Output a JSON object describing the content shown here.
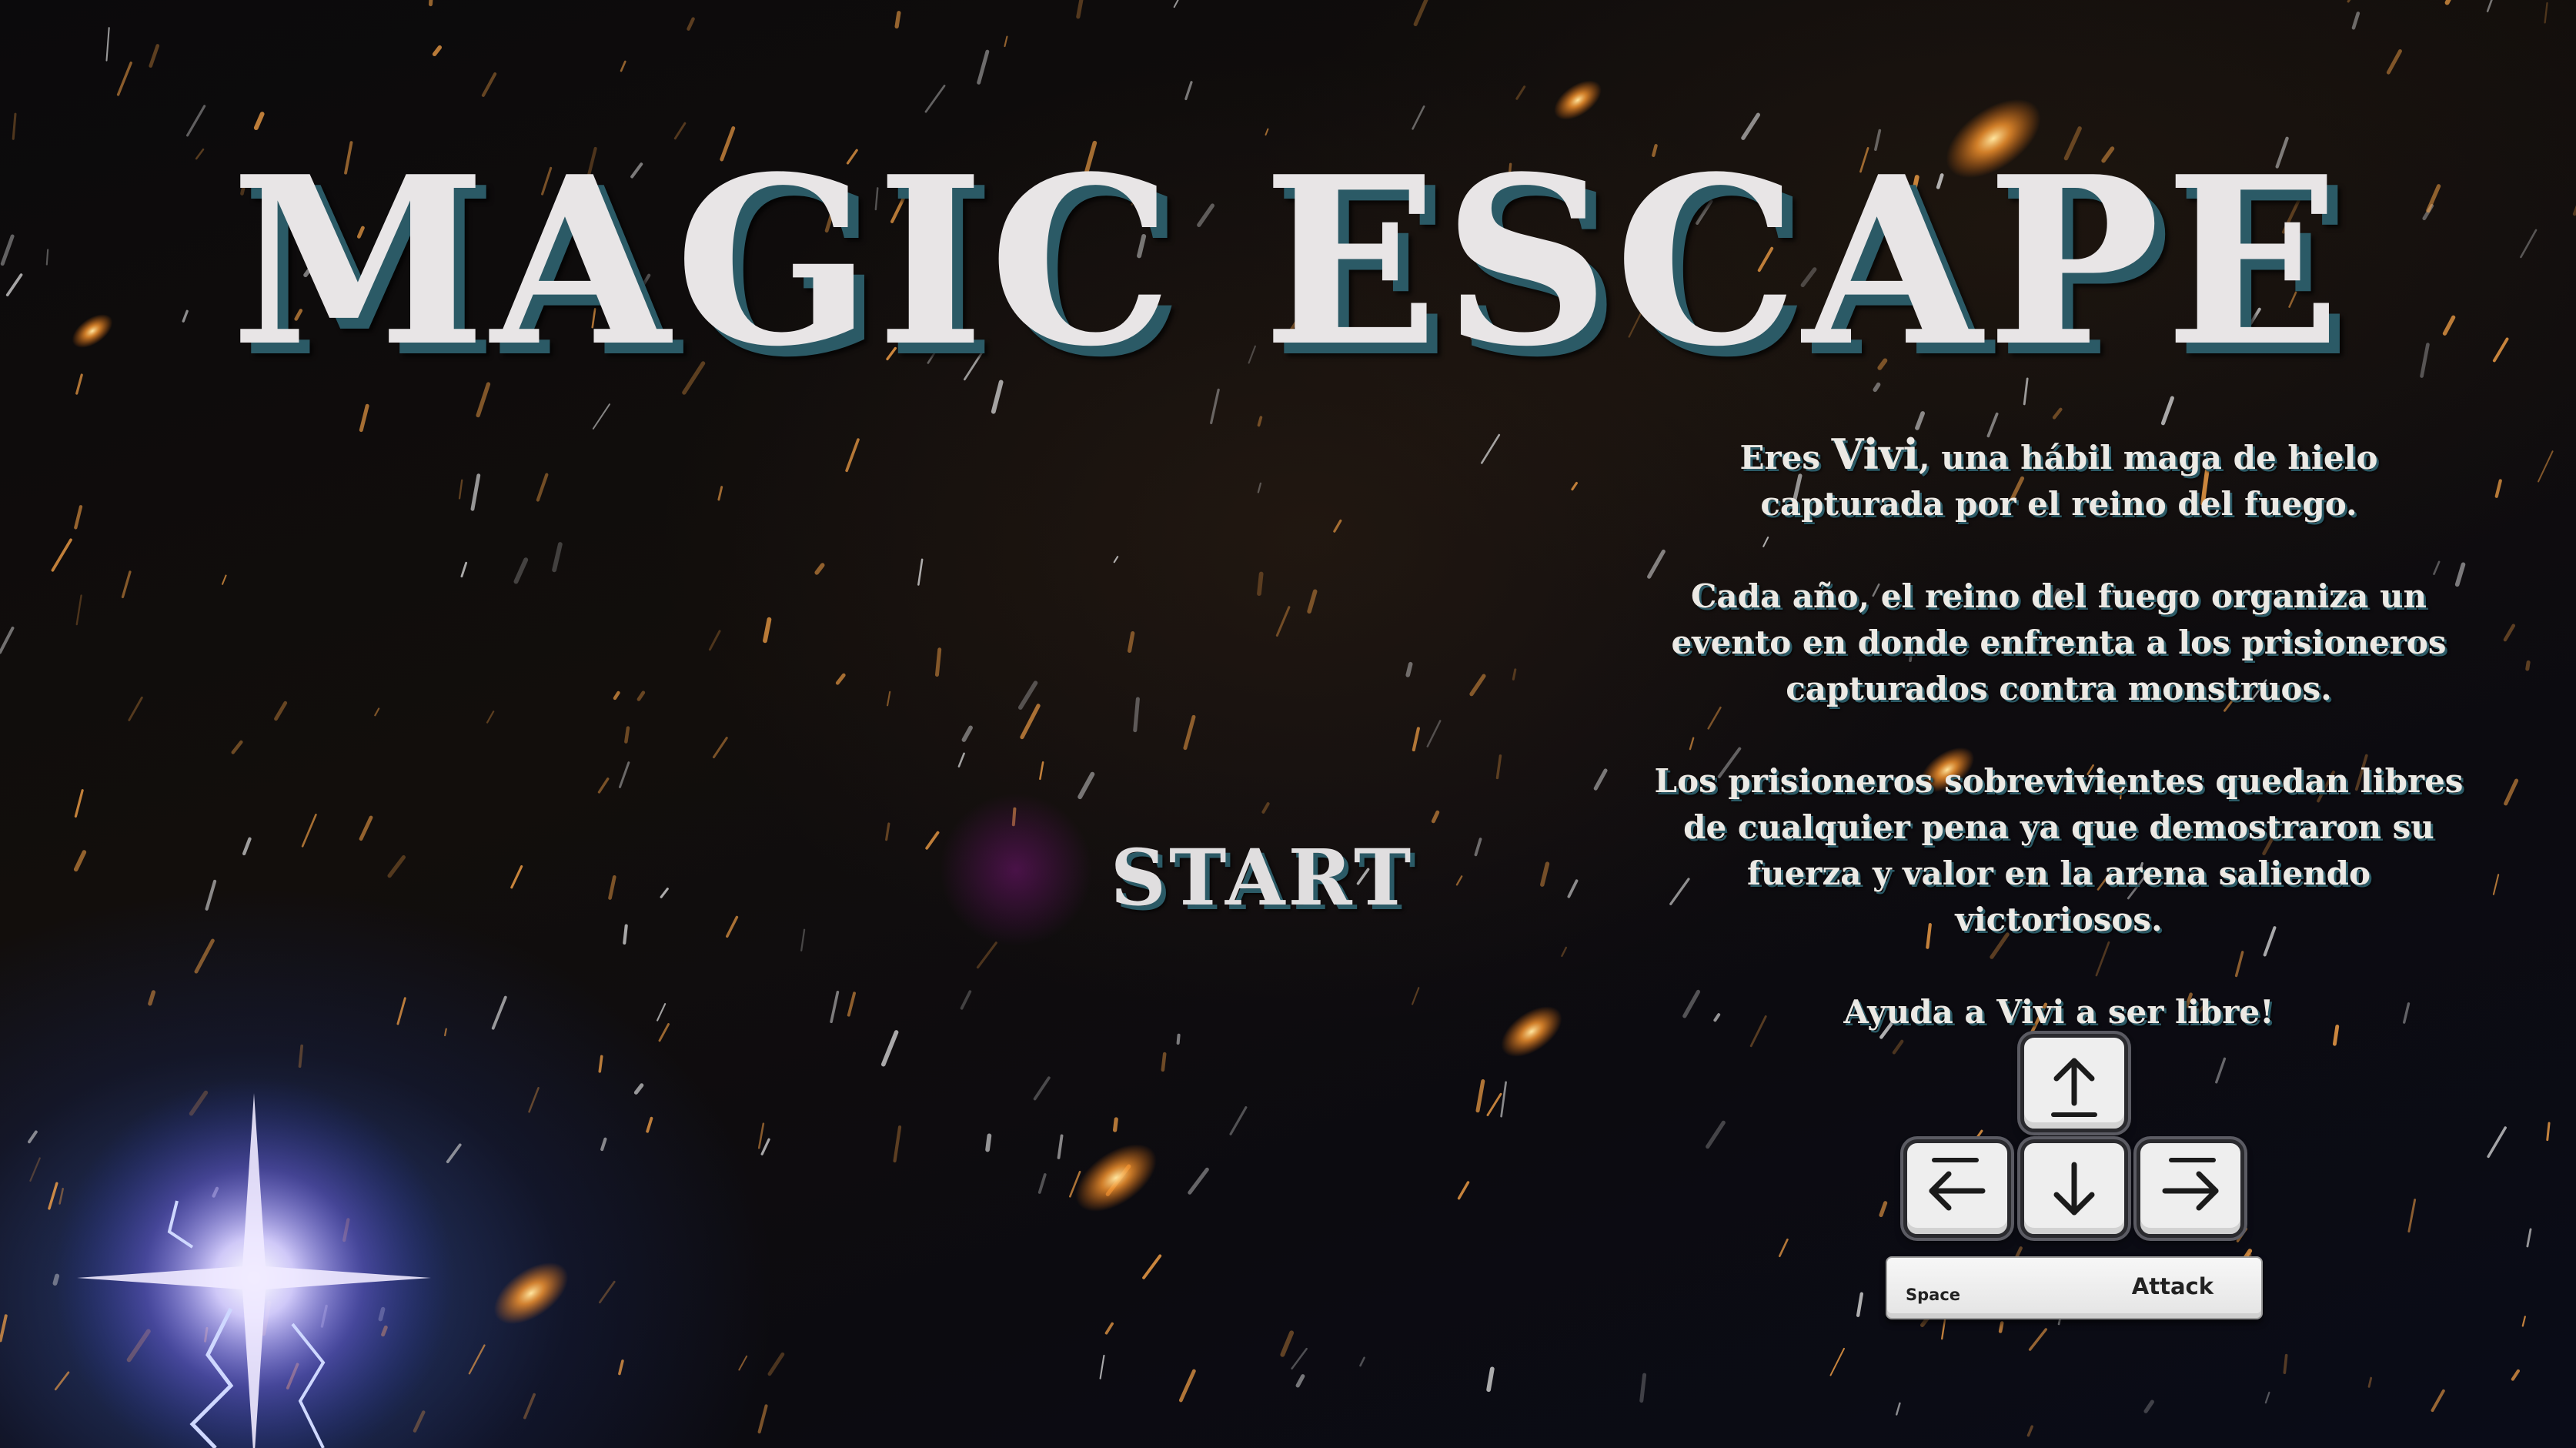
{
  "title": "MAGIC ESCAPE",
  "menu": {
    "start_label": "START"
  },
  "story": {
    "p1_before": "Eres ",
    "p1_name": "Vivi",
    "p1_after": ", una hábil maga de hielo capturada por el reino del fuego.",
    "p2": "Cada año, el reino del fuego organiza un evento en donde enfrenta a los prisioneros capturados contra monstruos.",
    "p3": "Los prisioneros sobrevivientes quedan libres de cualquier pena ya que demostraron su fuerza y valor en la arena saliendo victoriosos.",
    "p4": "Ayuda a Vivi a ser libre!"
  },
  "controls": {
    "arrow_keys": [
      "arrow-up-icon",
      "arrow-left-icon",
      "arrow-down-icon",
      "arrow-right-icon"
    ],
    "space_key_label": "Space",
    "space_action_label": "Attack"
  },
  "colors": {
    "title_text": "#e8e5e6",
    "title_shadow": "#2b5a66",
    "background": "#07060a",
    "spark": "#ffa84a",
    "lightning": "#9fb8ff"
  }
}
